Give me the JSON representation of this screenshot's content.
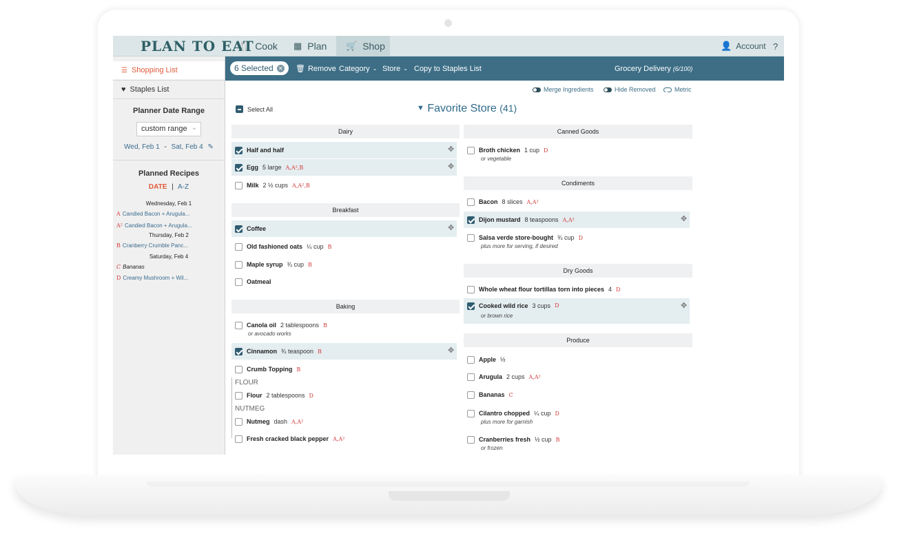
{
  "app": {
    "logo": "PLAN TO EAT"
  },
  "nav": {
    "tabs": [
      {
        "label": "Cook",
        "icon": "utensils-icon"
      },
      {
        "label": "Plan",
        "icon": "calendar-icon"
      },
      {
        "label": "Shop",
        "icon": "cart-icon"
      }
    ],
    "active_tab": "Shop",
    "account": "Account",
    "help": "?"
  },
  "sidebar": {
    "shopping_list": "Shopping List",
    "staples_list": "Staples List",
    "date_range_heading": "Planner Date Range",
    "date_range_select": "custom range",
    "date_from": "Wed, Feb 1",
    "date_sep": "-",
    "date_to": "Sat, Feb 4",
    "planned_heading": "Planned Recipes",
    "sort_date": "DATE",
    "sort_sep": "|",
    "sort_az": "A-Z",
    "days": [
      {
        "label": "Wednesday, Feb 1"
      },
      {
        "label": "Thursday, Feb 2"
      },
      {
        "label": "Saturday, Feb 4"
      }
    ],
    "recipes": [
      {
        "tag": "A",
        "name": "Candied Bacon + Arugula..."
      },
      {
        "tag": "A²",
        "name": "Candied Bacon + Arugula..."
      },
      {
        "tag": "B",
        "name": "Cranberry Crumble Panc..."
      },
      {
        "tag": "C",
        "name": "Bananas"
      },
      {
        "tag": "D",
        "name": "Creamy Mushroom + Wil..."
      }
    ]
  },
  "toolbar": {
    "selected": "6 Selected",
    "remove": "Remove",
    "category": "Category",
    "store": "Store",
    "copy": "Copy to Staples List",
    "delivery": "Grocery Delivery",
    "delivery_count": "(6/100)"
  },
  "options": {
    "merge": "Merge Ingredients",
    "hide": "Hide Removed",
    "metric": "Metric"
  },
  "list": {
    "select_all": "Select All",
    "store_name": "Favorite Store",
    "store_count": "(41)",
    "left_categories": [
      {
        "name": "Dairy",
        "items": [
          {
            "name": "Half and half",
            "qty": "",
            "recipes": "",
            "checked": true
          },
          {
            "name": "Egg",
            "qty": "5 large",
            "recipes": "A,A²,B",
            "checked": true
          },
          {
            "name": "Milk",
            "qty": "2 ½ cups",
            "recipes": "A,A²,B",
            "checked": false
          }
        ]
      },
      {
        "name": "Breakfast",
        "items": [
          {
            "name": "Coffee",
            "qty": "",
            "recipes": "",
            "checked": true
          },
          {
            "name": "Old fashioned oats",
            "qty": "¼ cup",
            "recipes": "B",
            "checked": false
          },
          {
            "name": "Maple syrup",
            "qty": "¾ cup",
            "recipes": "B",
            "checked": false
          },
          {
            "name": "Oatmeal",
            "qty": "",
            "recipes": "",
            "checked": false
          }
        ]
      },
      {
        "name": "Baking",
        "items": [
          {
            "name": "Canola oil",
            "qty": "2 tablespoons",
            "recipes": "B",
            "note": "or avocado works",
            "checked": false
          },
          {
            "name": "Cinnamon",
            "qty": "¾ teaspoon",
            "recipes": "B",
            "checked": true
          },
          {
            "name": "Crumb Topping",
            "qty": "",
            "recipes": "B",
            "checked": false
          },
          {
            "group": "FLOUR"
          },
          {
            "name": "Flour",
            "qty": "2 tablespoons",
            "recipes": "D",
            "checked": false
          },
          {
            "group": "NUTMEG"
          },
          {
            "name": "Nutmeg",
            "qty": "dash",
            "recipes": "A,A²",
            "checked": false
          },
          {
            "name": "Fresh cracked black pepper",
            "qty": "",
            "recipes": "A,A²",
            "checked": false
          }
        ]
      }
    ],
    "right_categories": [
      {
        "name": "Canned Goods",
        "items": [
          {
            "name": "Broth chicken",
            "qty": "1 cup",
            "recipes": "D",
            "note": "or vegetable",
            "checked": false
          }
        ]
      },
      {
        "name": "Condiments",
        "items": [
          {
            "name": "Bacon",
            "qty": "8 slices",
            "recipes": "A,A²",
            "checked": false
          },
          {
            "name": "Dijon mustard",
            "qty": "8 teaspoons",
            "recipes": "A,A²",
            "checked": true
          },
          {
            "name": "Salsa verde store-bought",
            "qty": "¾ cup",
            "recipes": "D",
            "note": "plus more for serving, if desired",
            "checked": false
          }
        ]
      },
      {
        "name": "Dry Goods",
        "items": [
          {
            "name": "Whole wheat flour tortillas torn into pieces",
            "qty": "4",
            "recipes": "D",
            "checked": false
          },
          {
            "name": "Cooked wild rice",
            "qty": "3 cups",
            "recipes": "D",
            "note": "or brown rice",
            "checked": true
          }
        ]
      },
      {
        "name": "Produce",
        "items": [
          {
            "name": "Apple",
            "qty": "½",
            "recipes": "",
            "checked": false
          },
          {
            "name": "Arugula",
            "qty": "2 cups",
            "recipes": "A,A²",
            "checked": false
          },
          {
            "name": "Bananas",
            "qty": "",
            "recipes": "C",
            "checked": false
          },
          {
            "name": "Cilantro chopped",
            "qty": "¼ cup",
            "recipes": "D",
            "note": "plus more for garnish",
            "checked": false
          },
          {
            "name": "Cranberries fresh",
            "qty": "½ cup",
            "recipes": "B",
            "note": "or frozen",
            "checked": false
          }
        ]
      }
    ]
  }
}
